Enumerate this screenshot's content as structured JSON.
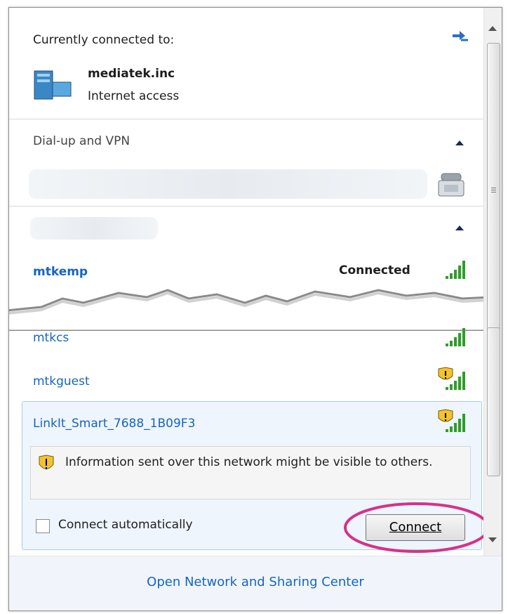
{
  "current": {
    "header": "Currently connected to:",
    "network": "mediatek.inc",
    "status": "Internet access"
  },
  "dialup": {
    "label": "Dial-up and VPN"
  },
  "wireless": {
    "networks": [
      {
        "name": "mtkemp",
        "status": "Connected"
      },
      {
        "name": "mtkcs"
      },
      {
        "name": "mtkguest"
      },
      {
        "name": "LinkIt_Smart_7688_1B09F3"
      }
    ]
  },
  "selected": {
    "warning": "Information sent over this network might be visible to others.",
    "auto_label": "Connect automatically",
    "connect_label": "Connect"
  },
  "footer": {
    "link": "Open Network and Sharing Center"
  },
  "colors": {
    "link": "#1565c0",
    "highlight_circle": "#d6318a",
    "signal": "#2e9d2a",
    "shield": "#f2c230"
  }
}
